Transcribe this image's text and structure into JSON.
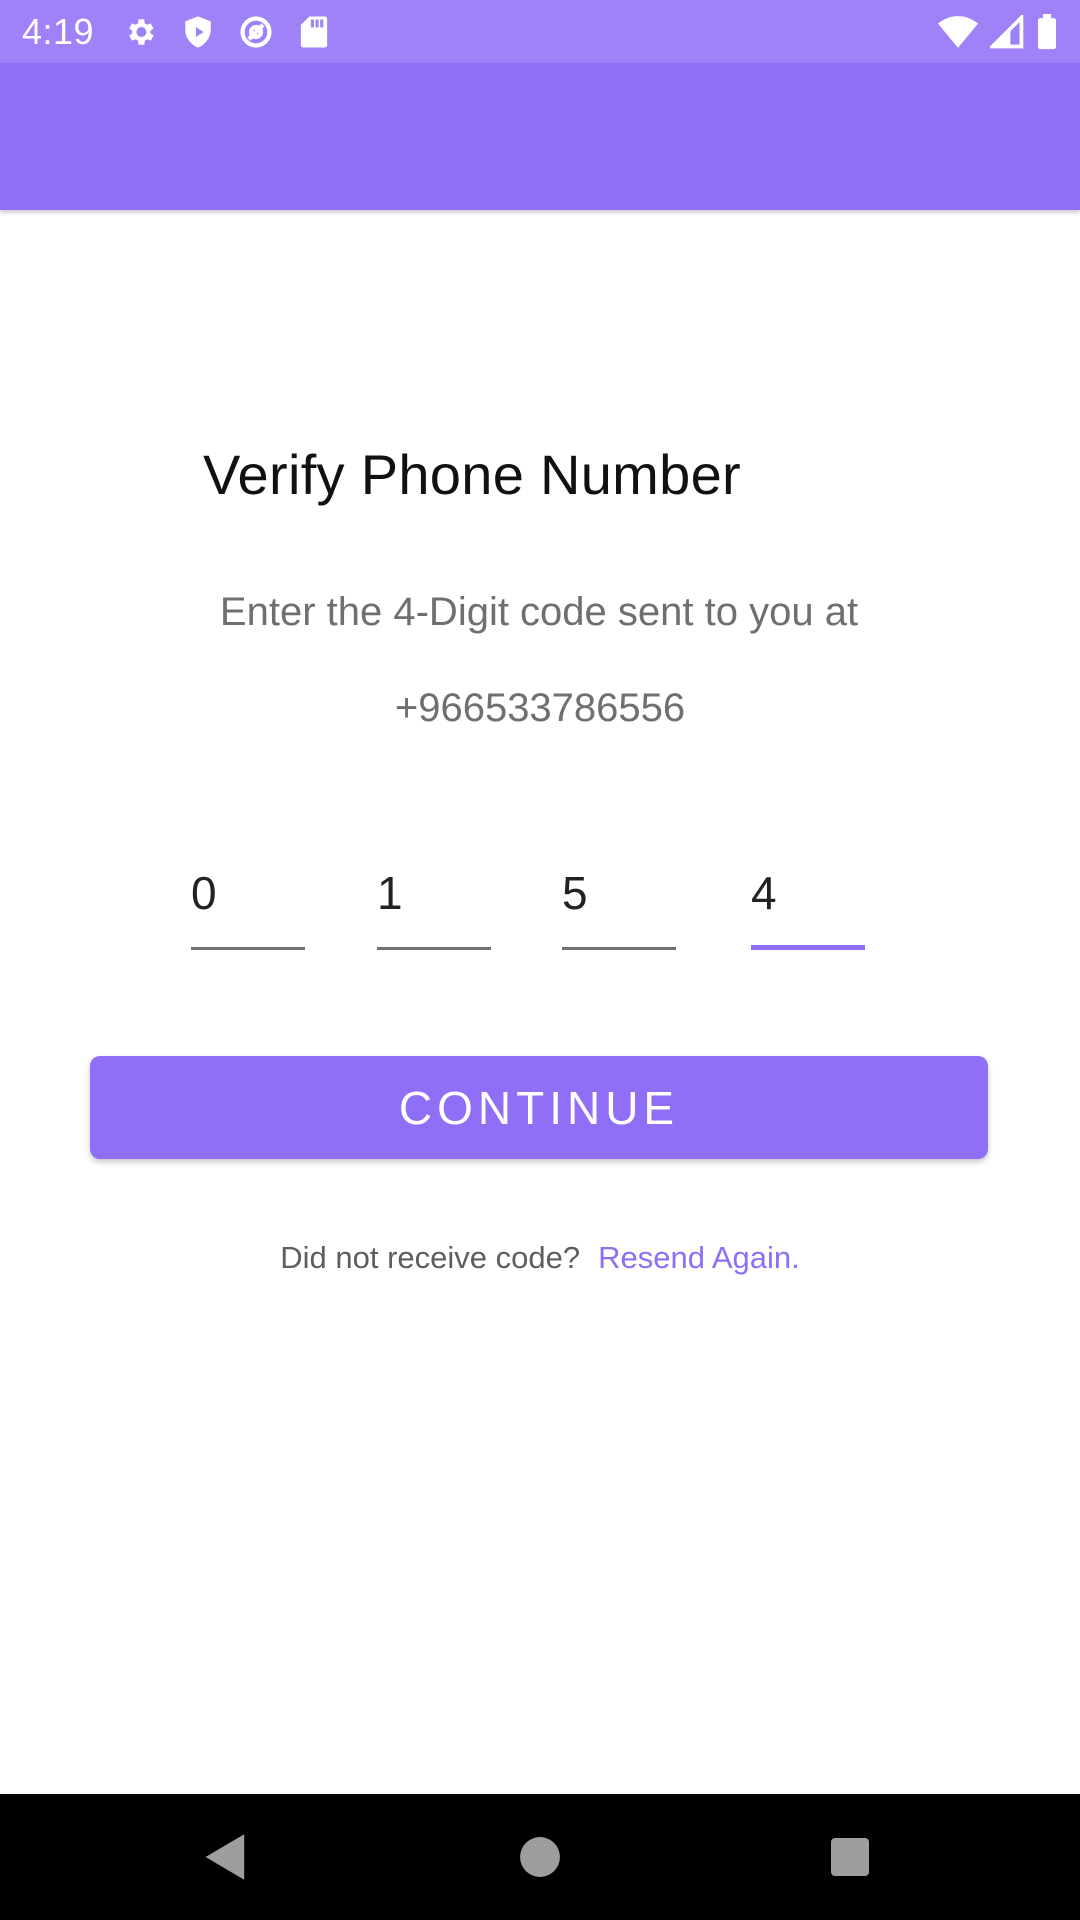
{
  "status_bar": {
    "time": "4:19",
    "icons_left": [
      "gear-icon",
      "shield-icon",
      "at-sign-icon",
      "sd-card-icon"
    ],
    "icons_right": [
      "wifi-icon",
      "cell-signal-icon",
      "battery-icon"
    ],
    "background_color": "#9f82f8"
  },
  "app_bar": {
    "background_color": "#8f6ff5"
  },
  "verify": {
    "title": "Verify Phone Number",
    "subtitle": "Enter the 4-Digit code sent to you at",
    "phone_number": "+966533786556",
    "otp_digits": [
      "0",
      "1",
      "5",
      "4"
    ],
    "continue_label": "CONTINUE",
    "resend_prompt": "Did not receive code?",
    "resend_link": "Resend Again."
  },
  "colors": {
    "accent": "#8f6ff5",
    "text_muted": "#6f6f6f"
  },
  "nav_bar": {
    "buttons": [
      "back-icon",
      "home-icon",
      "recents-icon"
    ]
  }
}
